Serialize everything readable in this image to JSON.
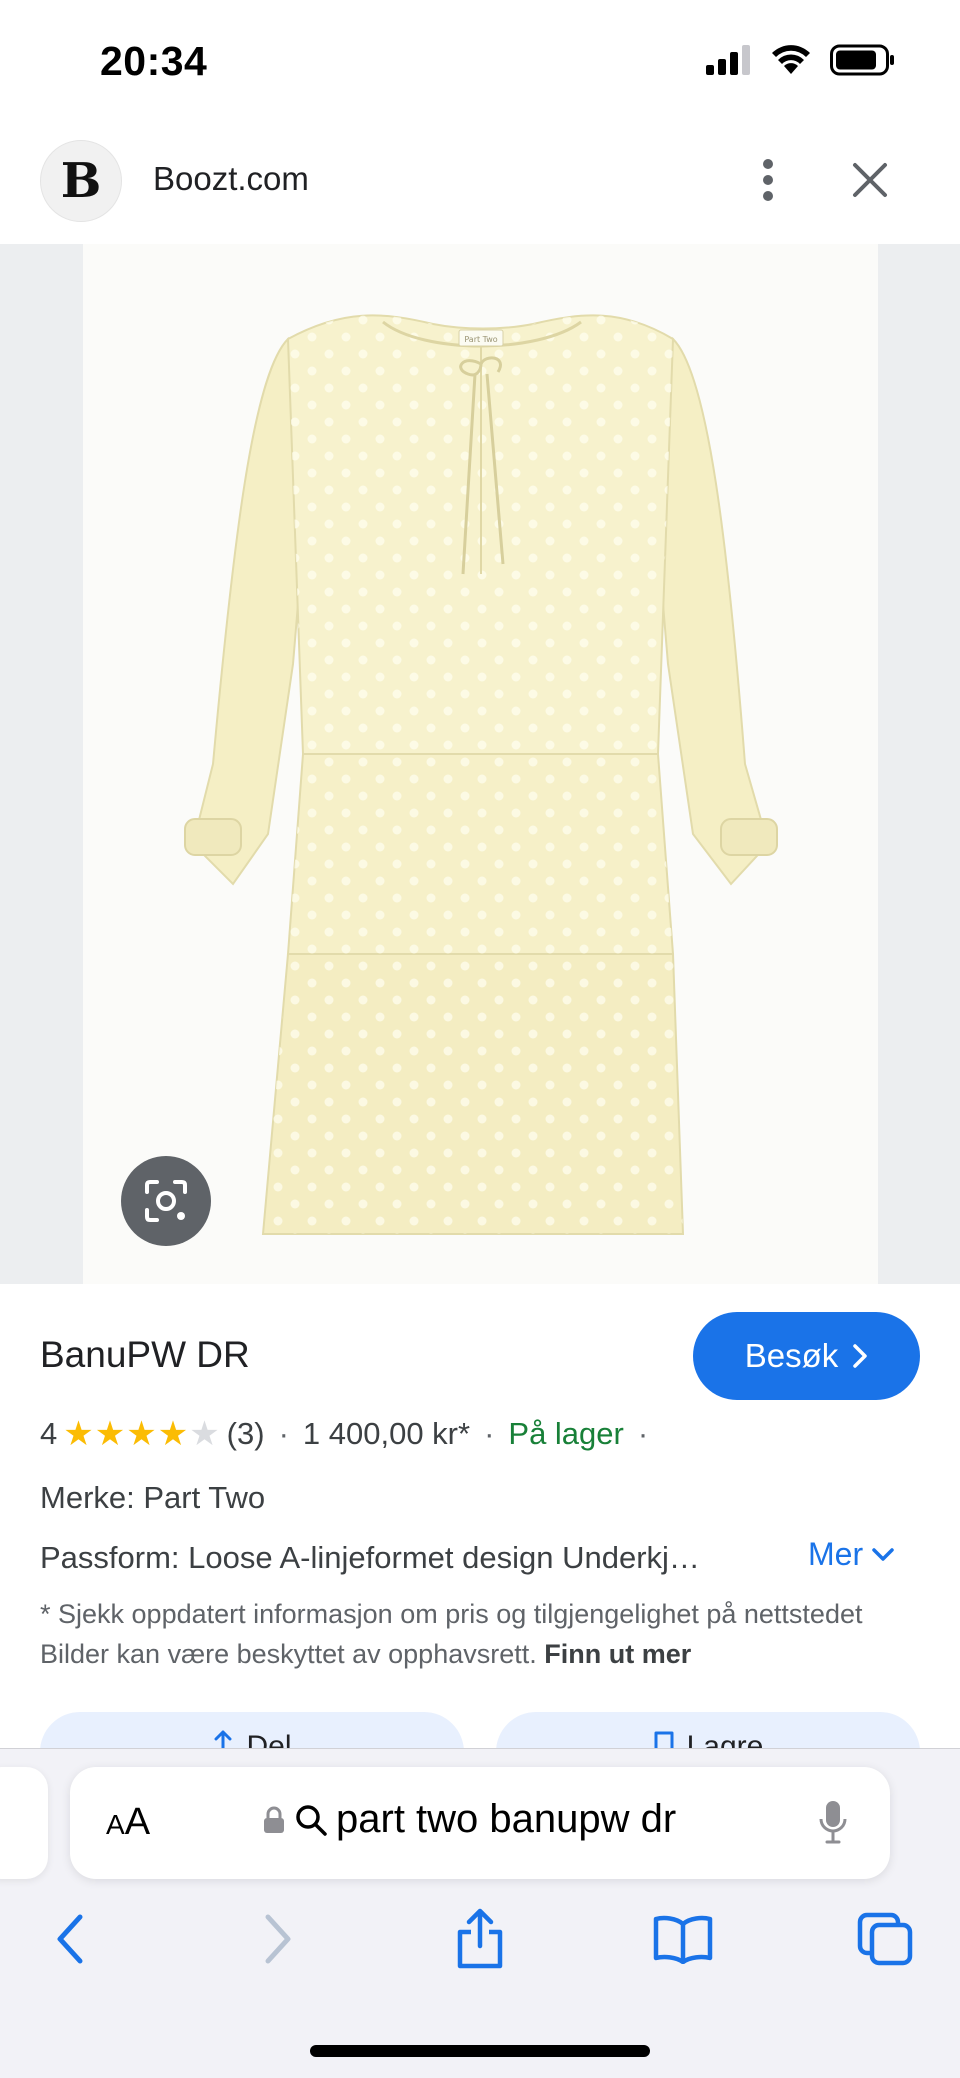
{
  "status_bar": {
    "time": "20:34"
  },
  "site": {
    "name": "Boozt.com",
    "logo_letter": "B"
  },
  "product": {
    "title": "BanuPW DR",
    "visit_label": "Besøk",
    "rating_value": "4",
    "stars_filled": 4,
    "stars_total": 5,
    "review_count": "(3)",
    "price": "1 400,00 kr*",
    "stock": "På lager",
    "brand": "Merke: Part Two",
    "fit": "Passform: Loose A-linjeformet design Underkj…",
    "more_label": "Mer",
    "disclaimer": "* Sjekk oppdatert informasjon om pris og tilgjengelighet på nettstedet Bilder kan være beskyttet av opphavsrett.",
    "learn_more": "Finn ut mer",
    "share_label": "Del",
    "save_label": "Lagre",
    "dress_label_text": "Part Two"
  },
  "browser": {
    "text_size_label_small": "A",
    "text_size_label_large": "A",
    "url_query": "part two banupw dr"
  },
  "colors": {
    "accent": "#1a73e8",
    "stock_green": "#188038",
    "star_gold": "#fbbc04",
    "dress_fill": "#f6f1c8"
  }
}
